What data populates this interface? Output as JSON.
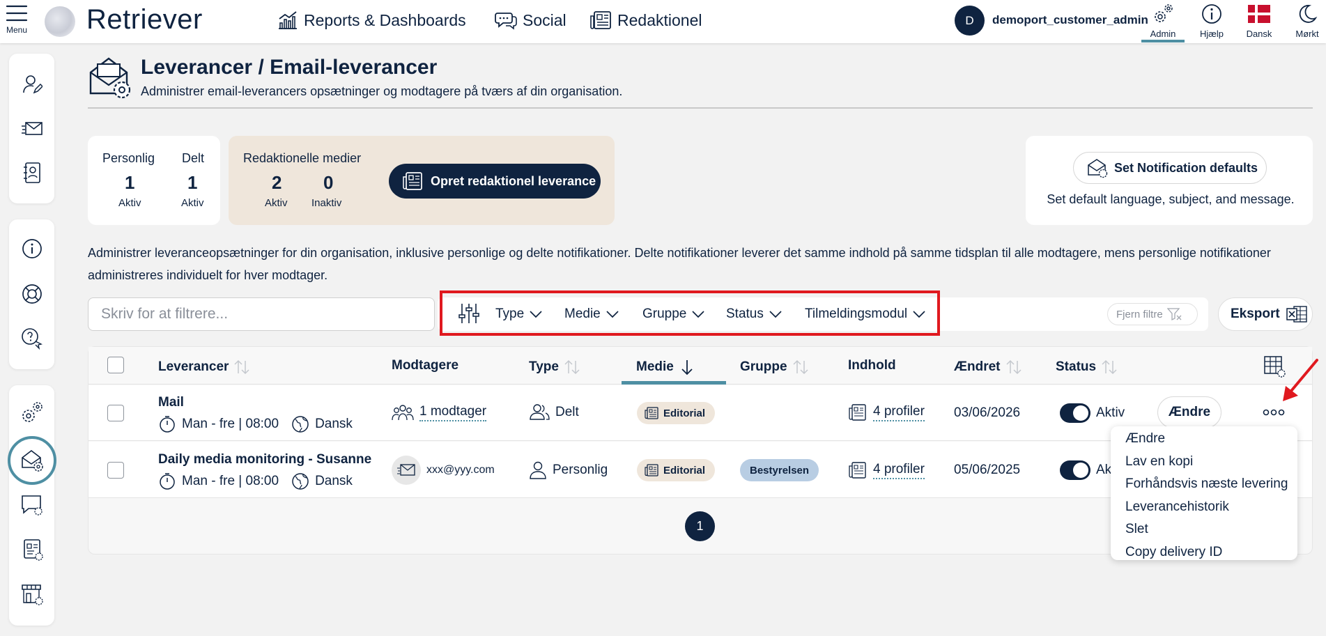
{
  "topbar": {
    "menu_label": "Menu",
    "logo_text": "Retriever",
    "nav": [
      {
        "label": "Reports & Dashboards",
        "icon": "chart-icon"
      },
      {
        "label": "Social",
        "icon": "chat-icon"
      },
      {
        "label": "Redaktionel",
        "icon": "newspaper-icon"
      }
    ],
    "user_initial": "D",
    "user_name": "demoport_customer_admin",
    "tools": [
      {
        "label": "Admin",
        "icon": "gear-icon"
      },
      {
        "label": "Hjælp",
        "icon": "info-icon"
      },
      {
        "label": "Dansk",
        "icon": "danish-flag-icon"
      },
      {
        "label": "Mørkt",
        "icon": "moon-icon"
      }
    ]
  },
  "header": {
    "title": "Leverancer / Email-leverancer",
    "subtitle": "Administrer email-leverancers opsætninger og modtagere på tværs af din organisation."
  },
  "stats": {
    "personal": {
      "label": "Personlig",
      "value": "1",
      "sub": "Aktiv"
    },
    "shared": {
      "label": "Delt",
      "value": "1",
      "sub": "Aktiv"
    },
    "editorial_label": "Redaktionelle medier",
    "editorial_active": {
      "value": "2",
      "sub": "Aktiv"
    },
    "editorial_inactive": {
      "value": "0",
      "sub": "Inaktiv"
    },
    "create_button": "Opret redaktionel leverance"
  },
  "notification": {
    "button": "Set Notification defaults",
    "description": "Set default language, subject, and message."
  },
  "description": "Administrer leveranceopsætninger for din organisation, inklusive personlige og delte notifikationer. Delte notifikationer leverer det samme indhold på samme tidsplan til alle modtagere, mens personlige notifikationer administreres individuelt for hver modtager.",
  "filters": {
    "search_placeholder": "Skriv for at filtrere...",
    "type": "Type",
    "medie": "Medie",
    "gruppe": "Gruppe",
    "status": "Status",
    "module": "Tilmeldingsmodul",
    "clear": "Fjern filtre",
    "export": "Eksport"
  },
  "table": {
    "headers": {
      "leverancer": "Leverancer",
      "modtagere": "Modtagere",
      "type": "Type",
      "medie": "Medie",
      "gruppe": "Gruppe",
      "indhold": "Indhold",
      "aendret": "Ændret",
      "status": "Status"
    },
    "rows": [
      {
        "name": "Mail",
        "schedule": "Man - fre | 08:00",
        "language": "Dansk",
        "recipients": "1 modtager",
        "type": "Delt",
        "medie": "Editorial",
        "gruppe": "",
        "indhold": "4 profiler",
        "changed": "03/06/2026",
        "status": "Aktiv",
        "edit": "Ændre"
      },
      {
        "name": "Daily media monitoring - Susanne",
        "schedule": "Man - fre | 08:00",
        "language": "Dansk",
        "recipients": "xxx@yyy.com",
        "type": "Personlig",
        "medie": "Editorial",
        "gruppe": "Bestyrelsen",
        "indhold": "4 profiler",
        "changed": "05/06/2025",
        "status": "Ak"
      }
    ]
  },
  "pagination": {
    "current": "1"
  },
  "dropdown": [
    "Ændre",
    "Lav en kopi",
    "Forhåndsvis næste levering",
    "Leverancehistorik",
    "Slet",
    "Copy delivery ID"
  ],
  "colors": {
    "navy": "#0f2340",
    "teal": "#4e8fa3",
    "highlight_red": "#e0191f",
    "editorial_badge": "#efe6db",
    "group_badge": "#b8cde3"
  }
}
